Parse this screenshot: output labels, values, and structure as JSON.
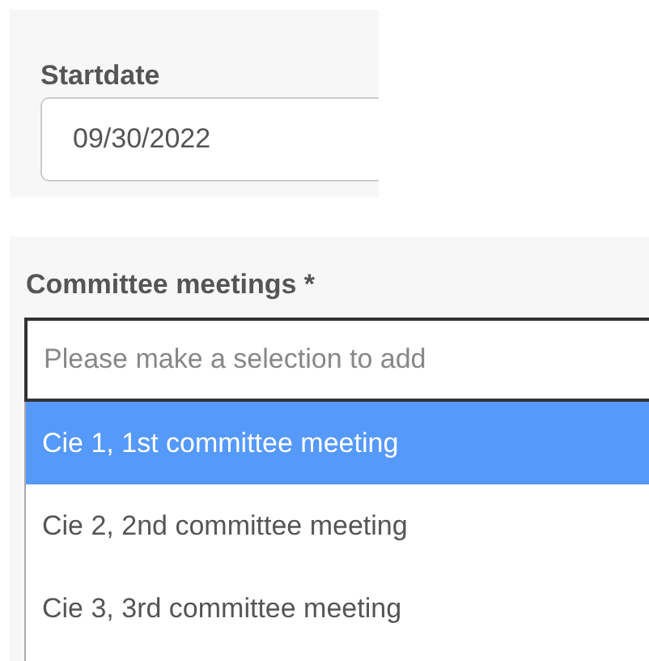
{
  "startdate": {
    "label": "Startdate",
    "value": "09/30/2022"
  },
  "committee_meetings": {
    "label": "Committee meetings *",
    "placeholder": "Please make a selection to add",
    "options": [
      {
        "label": "Cie 1, 1st committee meeting",
        "selected": true
      },
      {
        "label": "Cie 2, 2nd committee meeting",
        "selected": false
      },
      {
        "label": "Cie 3, 3rd committee meeting",
        "selected": false
      }
    ]
  }
}
